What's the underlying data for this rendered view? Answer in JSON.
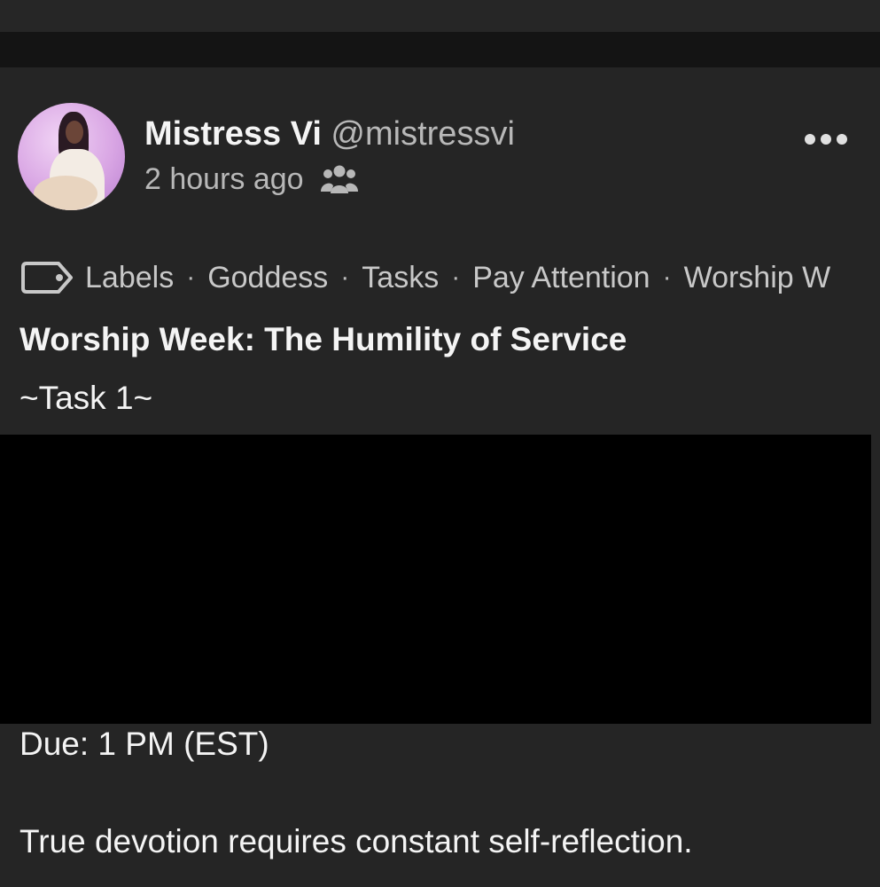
{
  "post": {
    "author": {
      "display_name": "Mistress Vi",
      "handle": "@mistressvi",
      "avatar_icon": "avatar-photo"
    },
    "timestamp": "2 hours ago",
    "visibility_icon": "group-icon",
    "menu_icon": "more-options-icon",
    "labels_icon": "tag-icon",
    "labels": [
      "Labels",
      "Goddess",
      "Tasks",
      "Pay Attention",
      "Worship W"
    ],
    "title": "Worship Week: The Humility of Service",
    "task_heading": "~Task 1~",
    "due": "Due: 1 PM (EST)",
    "body": "True devotion requires constant self-reflection."
  },
  "colors": {
    "background": "#242424",
    "text_primary": "#f4f4f4",
    "text_secondary": "#b8b8b8",
    "redaction": "#000000"
  }
}
